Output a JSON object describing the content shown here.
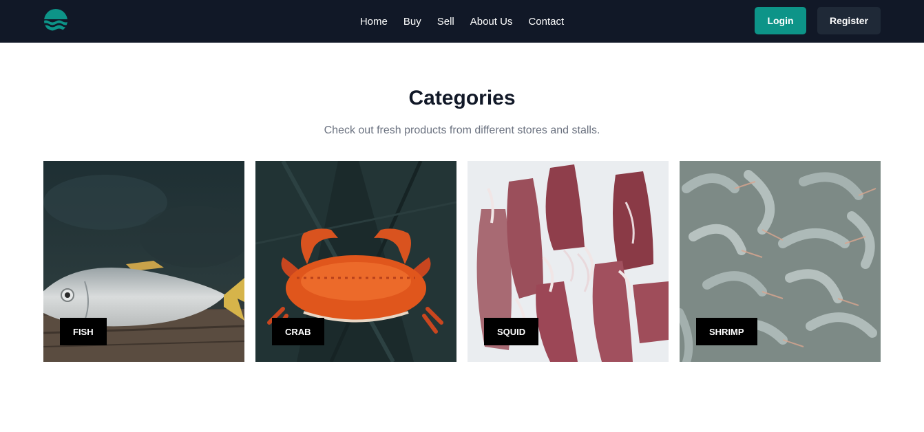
{
  "nav": {
    "links": [
      "Home",
      "Buy",
      "Sell",
      "About Us",
      "Contact"
    ],
    "login_label": "Login",
    "register_label": "Register",
    "logo_icon": "wave-logo-icon"
  },
  "section": {
    "title": "Categories",
    "subtitle": "Check out fresh products from different stores and stalls."
  },
  "categories": [
    {
      "label": "FISH",
      "image": "fish-photo"
    },
    {
      "label": "CRAB",
      "image": "crab-photo"
    },
    {
      "label": "SQUID",
      "image": "squid-photo"
    },
    {
      "label": "SHRIMP",
      "image": "shrimp-photo"
    }
  ],
  "colors": {
    "nav_bg": "#111827",
    "accent": "#0d9488",
    "register_bg": "#1f2937",
    "label_bg": "#000000"
  }
}
